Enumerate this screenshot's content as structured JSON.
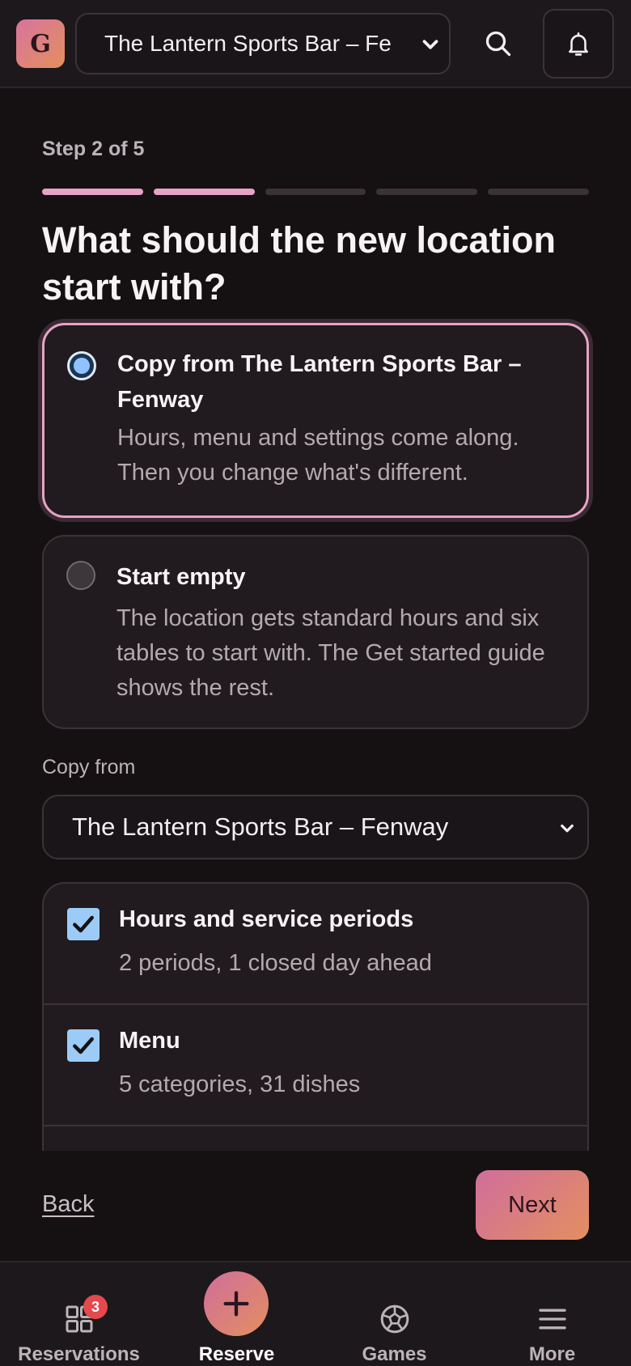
{
  "header": {
    "logo_letter": "G",
    "location": "The Lantern Sports Bar – Fe",
    "search_icon": "search-icon",
    "bell_icon": "bell-icon"
  },
  "wizard": {
    "step_label": "Step 2 of 5",
    "current_step": 2,
    "total_steps": 5,
    "heading": "What should the new location start with?",
    "options": [
      {
        "title": "Copy from The Lantern Sports Bar – Fenway",
        "description": "Hours, menu and settings come along. Then you change what's different.",
        "selected": true
      },
      {
        "title": "Start empty",
        "description": "The location gets standard hours and six tables to start with. The Get started guide shows the rest.",
        "selected": false
      }
    ],
    "copy_from_label": "Copy from",
    "copy_from_value": "The Lantern Sports Bar – Fenway",
    "copy_items": [
      {
        "title": "Hours and service periods",
        "subtitle": "2 periods, 1 closed day ahead",
        "checked": true
      },
      {
        "title": "Menu",
        "subtitle": "5 categories, 31 dishes",
        "checked": true
      }
    ],
    "back_label": "Back",
    "next_label": "Next"
  },
  "bottom_nav": {
    "items": [
      {
        "label": "Reservations",
        "icon": "grid-icon",
        "badge": "3"
      },
      {
        "label": "Reserve",
        "icon": "plus-icon",
        "active": true
      },
      {
        "label": "Games",
        "icon": "soccer-ball-icon"
      },
      {
        "label": "More",
        "icon": "menu-icon"
      }
    ]
  },
  "colors": {
    "accent": "#e6a3c6",
    "gradient_start": "#d06e9c",
    "gradient_end": "#e38f5f",
    "checkbox": "#9ccbf7",
    "badge": "#e5484d"
  }
}
